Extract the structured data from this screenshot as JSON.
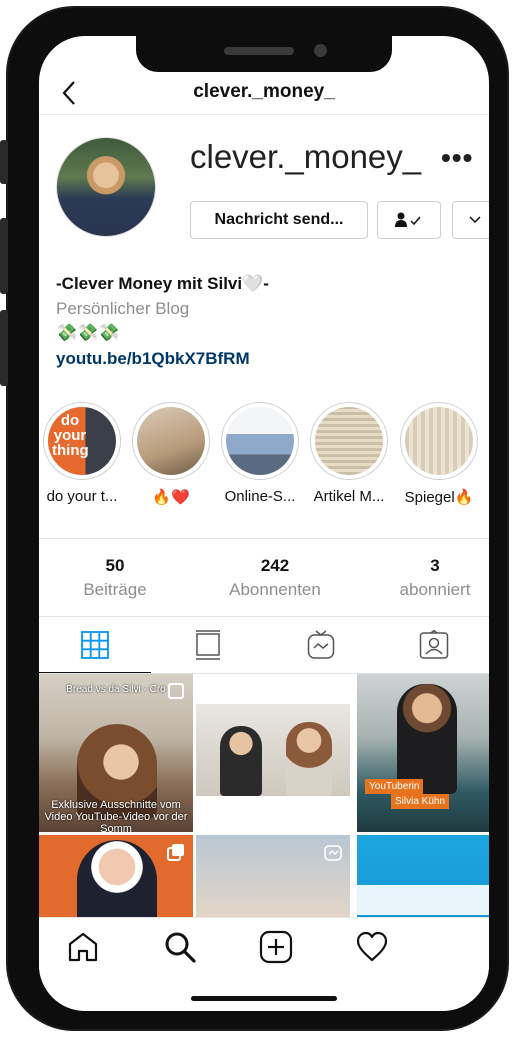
{
  "header": {
    "title": "clever._money_"
  },
  "profile": {
    "username": "clever._money_",
    "message_button": "Nachricht send...",
    "bio_name": "-Clever Money mit Silvi🤍-",
    "category": "Persönlicher Blog",
    "emoji_line": "💸💸💸",
    "link": "youtu.be/b1QbkX7BfRM"
  },
  "highlights": [
    {
      "label": "do your t...",
      "cover_text": "do your thing"
    },
    {
      "label": "🔥❤️"
    },
    {
      "label": "Online-S..."
    },
    {
      "label": "Artikel M..."
    },
    {
      "label": "Spiegel🔥"
    }
  ],
  "stats": [
    {
      "value": "50",
      "label": "Beiträge"
    },
    {
      "value": "242",
      "label": "Abonnenten"
    },
    {
      "value": "3",
      "label": "abonniert"
    }
  ],
  "tabs": [
    "grid-icon",
    "feed-icon",
    "igtv-icon",
    "tagged-icon"
  ],
  "posts": {
    "post1_top": "Bread vs da Silvi - Cro",
    "post1_caption": "Exklusive Ausschnitte vom Video YouTube-Video vor der Somm",
    "post3_tag1": "YouTuberin",
    "post3_tag2": "Silvia Kühn"
  },
  "bottom_nav": [
    "home-icon",
    "search-icon",
    "new-post-icon",
    "activity-icon"
  ],
  "colors": {
    "link": "#00376b",
    "accent": "#0095f6",
    "muted": "#8e8e8e"
  }
}
